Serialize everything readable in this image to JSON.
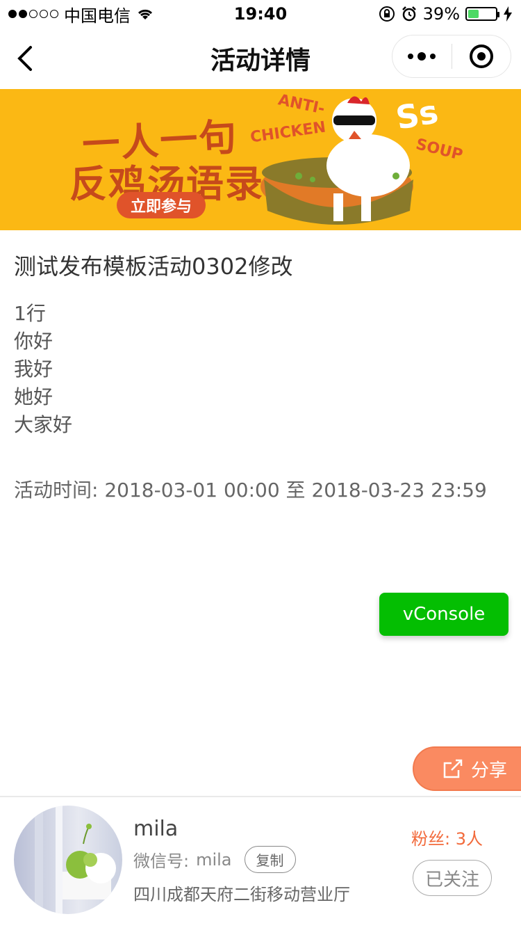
{
  "status_bar": {
    "carrier": "中国电信",
    "time": "19:40",
    "battery_percent": "39%",
    "battery_level": 0.39
  },
  "nav": {
    "title": "活动详情"
  },
  "banner": {
    "title_line1": "一人一句",
    "title_line2": "反鸡汤语录",
    "button_label": "立即参与",
    "text_anti": "ANTI-",
    "text_chicken": "CHICKEN",
    "text_ss": "Ss",
    "text_soup": "SOUP"
  },
  "activity": {
    "title": "测试发布模板活动0302修改",
    "description_lines": [
      "1行",
      "你好",
      "我好",
      "她好",
      "大家好"
    ],
    "time": "活动时间: 2018-03-01 00:00 至 2018-03-23 23:59"
  },
  "vconsole": {
    "label": "vConsole"
  },
  "share": {
    "label": "分享"
  },
  "footer": {
    "name": "mila",
    "wechat_label": "微信号:",
    "wechat_id": "mila",
    "copy_label": "复制",
    "shop": "四川成都天府二街移动营业厅",
    "fans": "粉丝: 3人",
    "follow_label": "已关注"
  },
  "colors": {
    "banner_bg": "#fbb814",
    "vconsole_green": "#04be02",
    "share_orange": "#fa8a61",
    "fans_orange": "#f26a3b",
    "battery_green": "#4cd964"
  }
}
